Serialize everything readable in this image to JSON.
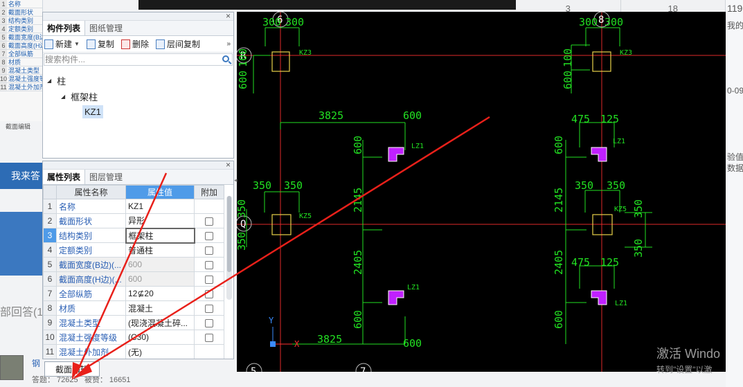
{
  "background_page": {
    "left_strip_rows": [
      {
        "num": "1",
        "label": "名称"
      },
      {
        "num": "2",
        "label": "截面形状"
      },
      {
        "num": "3",
        "label": "结构类别"
      },
      {
        "num": "4",
        "label": "定额类别"
      },
      {
        "num": "5",
        "label": "截面宽度(B边)"
      },
      {
        "num": "6",
        "label": "截面高度(H边)"
      },
      {
        "num": "7",
        "label": "全部纵筋"
      },
      {
        "num": "8",
        "label": "材质"
      },
      {
        "num": "9",
        "label": "混凝土类型"
      },
      {
        "num": "10",
        "label": "混凝土强度等级"
      },
      {
        "num": "11",
        "label": "混凝土外加剂"
      }
    ],
    "strip_footer": "截面编辑",
    "answer_button": "我来答",
    "answers_heading": "部回答(1",
    "username": "钢",
    "stats_label": "答题： 72625   被赞： 16651",
    "right_table_cells": [
      "3",
      "18",
      "119"
    ],
    "right_texts": [
      "我的",
      "0-09",
      "验值",
      "数据"
    ]
  },
  "windows_activation": {
    "line1": "激活 Windo",
    "line2": "转到\"设置\"以激"
  },
  "component_panel": {
    "tabs": [
      "构件列表",
      "图纸管理"
    ],
    "toolbar": {
      "new_label": "新建",
      "copy_label": "复制",
      "delete_label": "删除",
      "floor_copy_label": "层间复制",
      "more_label": "»"
    },
    "search_placeholder": "搜索构件...",
    "tree": {
      "root": "柱",
      "child": "框架柱",
      "leaf": "KZ1"
    }
  },
  "property_panel": {
    "tabs": [
      "属性列表",
      "图层管理"
    ],
    "columns": [
      "属性名称",
      "属性值",
      "附加"
    ],
    "rows": [
      {
        "num": "1",
        "name": "名称",
        "value": "KZ1",
        "has_checkbox": false
      },
      {
        "num": "2",
        "name": "截面形状",
        "value": "异形",
        "has_checkbox": true
      },
      {
        "num": "3",
        "name": "结构类别",
        "value": "框架柱",
        "has_checkbox": true
      },
      {
        "num": "4",
        "name": "定额类别",
        "value": "普通柱",
        "has_checkbox": true
      },
      {
        "num": "5",
        "name": "截面宽度(B边)(...",
        "value": "600",
        "has_checkbox": true
      },
      {
        "num": "6",
        "name": "截面高度(H边)(...",
        "value": "600",
        "has_checkbox": true
      },
      {
        "num": "7",
        "name": "全部纵筋",
        "value": "12⊈20",
        "has_checkbox": true
      },
      {
        "num": "8",
        "name": "材质",
        "value": "混凝土",
        "has_checkbox": true
      },
      {
        "num": "9",
        "name": "混凝土类型",
        "value": "(现浇混凝土碎...",
        "has_checkbox": true
      },
      {
        "num": "10",
        "name": "混凝土强度等级",
        "value": "(C30)",
        "has_checkbox": true
      },
      {
        "num": "11",
        "name": "混凝土外加剂",
        "value": "(无)",
        "has_checkbox": false
      }
    ],
    "section_edit_button": "截面编辑"
  },
  "cad_drawing": {
    "axis_labels": {
      "col6": "6",
      "col8": "8",
      "rowR": "R",
      "rowQ": "Q",
      "col5": "5",
      "col7": "7"
    },
    "dimensions": [
      "300",
      "300",
      "300",
      "300",
      "100",
      "600",
      "100",
      "600",
      "3825",
      "600",
      "475",
      "125",
      "600",
      "600",
      "350",
      "350",
      "350",
      "350",
      "2145",
      "2145",
      "350",
      "350",
      "350",
      "350",
      "2405",
      "2405",
      "475",
      "125",
      "600",
      "600",
      "3825",
      "600"
    ],
    "column_tags": [
      "KZ3",
      "KZ3",
      "LZ1",
      "LZ1",
      "KZ5",
      "KZ5",
      "LZ1",
      "LZ1"
    ],
    "ucs_x": "X",
    "ucs_y": "Y"
  }
}
